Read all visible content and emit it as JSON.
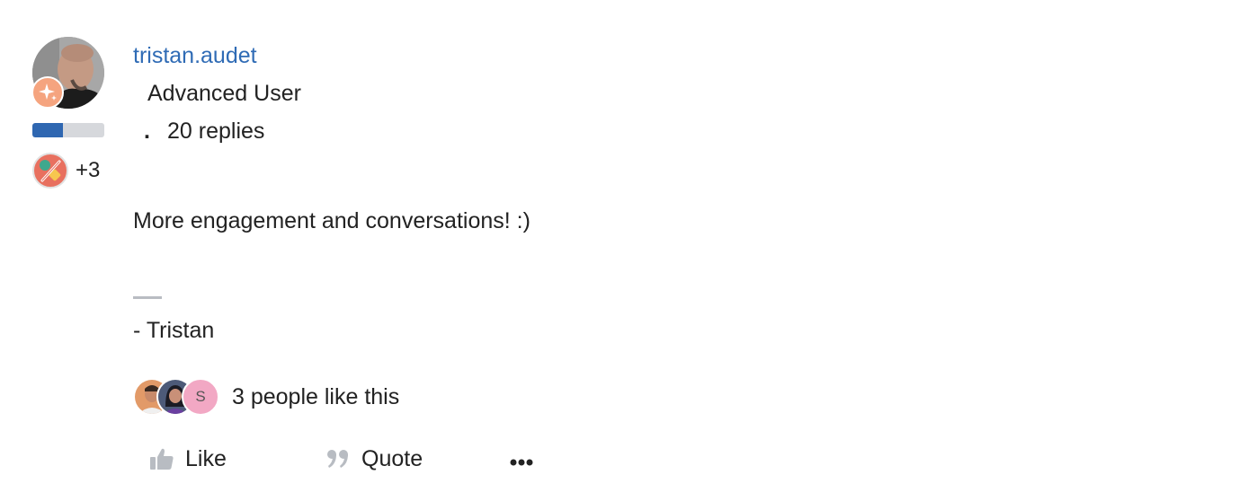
{
  "post": {
    "author": {
      "username": "tristan.audet",
      "rank": "Advanced User",
      "replies": "20 replies",
      "rank_progress": 0.42,
      "extra_badges": "+3"
    },
    "body": "More engagement and conversations! :)",
    "signature": "- Tristan",
    "likes": {
      "text": "3 people like this",
      "third_liker_initial": "S"
    },
    "actions": {
      "like": "Like",
      "quote": "Quote",
      "more": "•••"
    }
  },
  "icons": {
    "rank_badge": "sparkle-icon",
    "achievement": "pencil-dots-icon",
    "like": "thumbs-up-icon",
    "quote": "quote-icon",
    "more": "more-dots-icon"
  },
  "colors": {
    "link": "#2f6bb5",
    "progress_fill": "#2f67b1",
    "progress_track": "#d6d8dc",
    "rank_badge": "#f5a47f",
    "achievement": "#e8705f"
  }
}
